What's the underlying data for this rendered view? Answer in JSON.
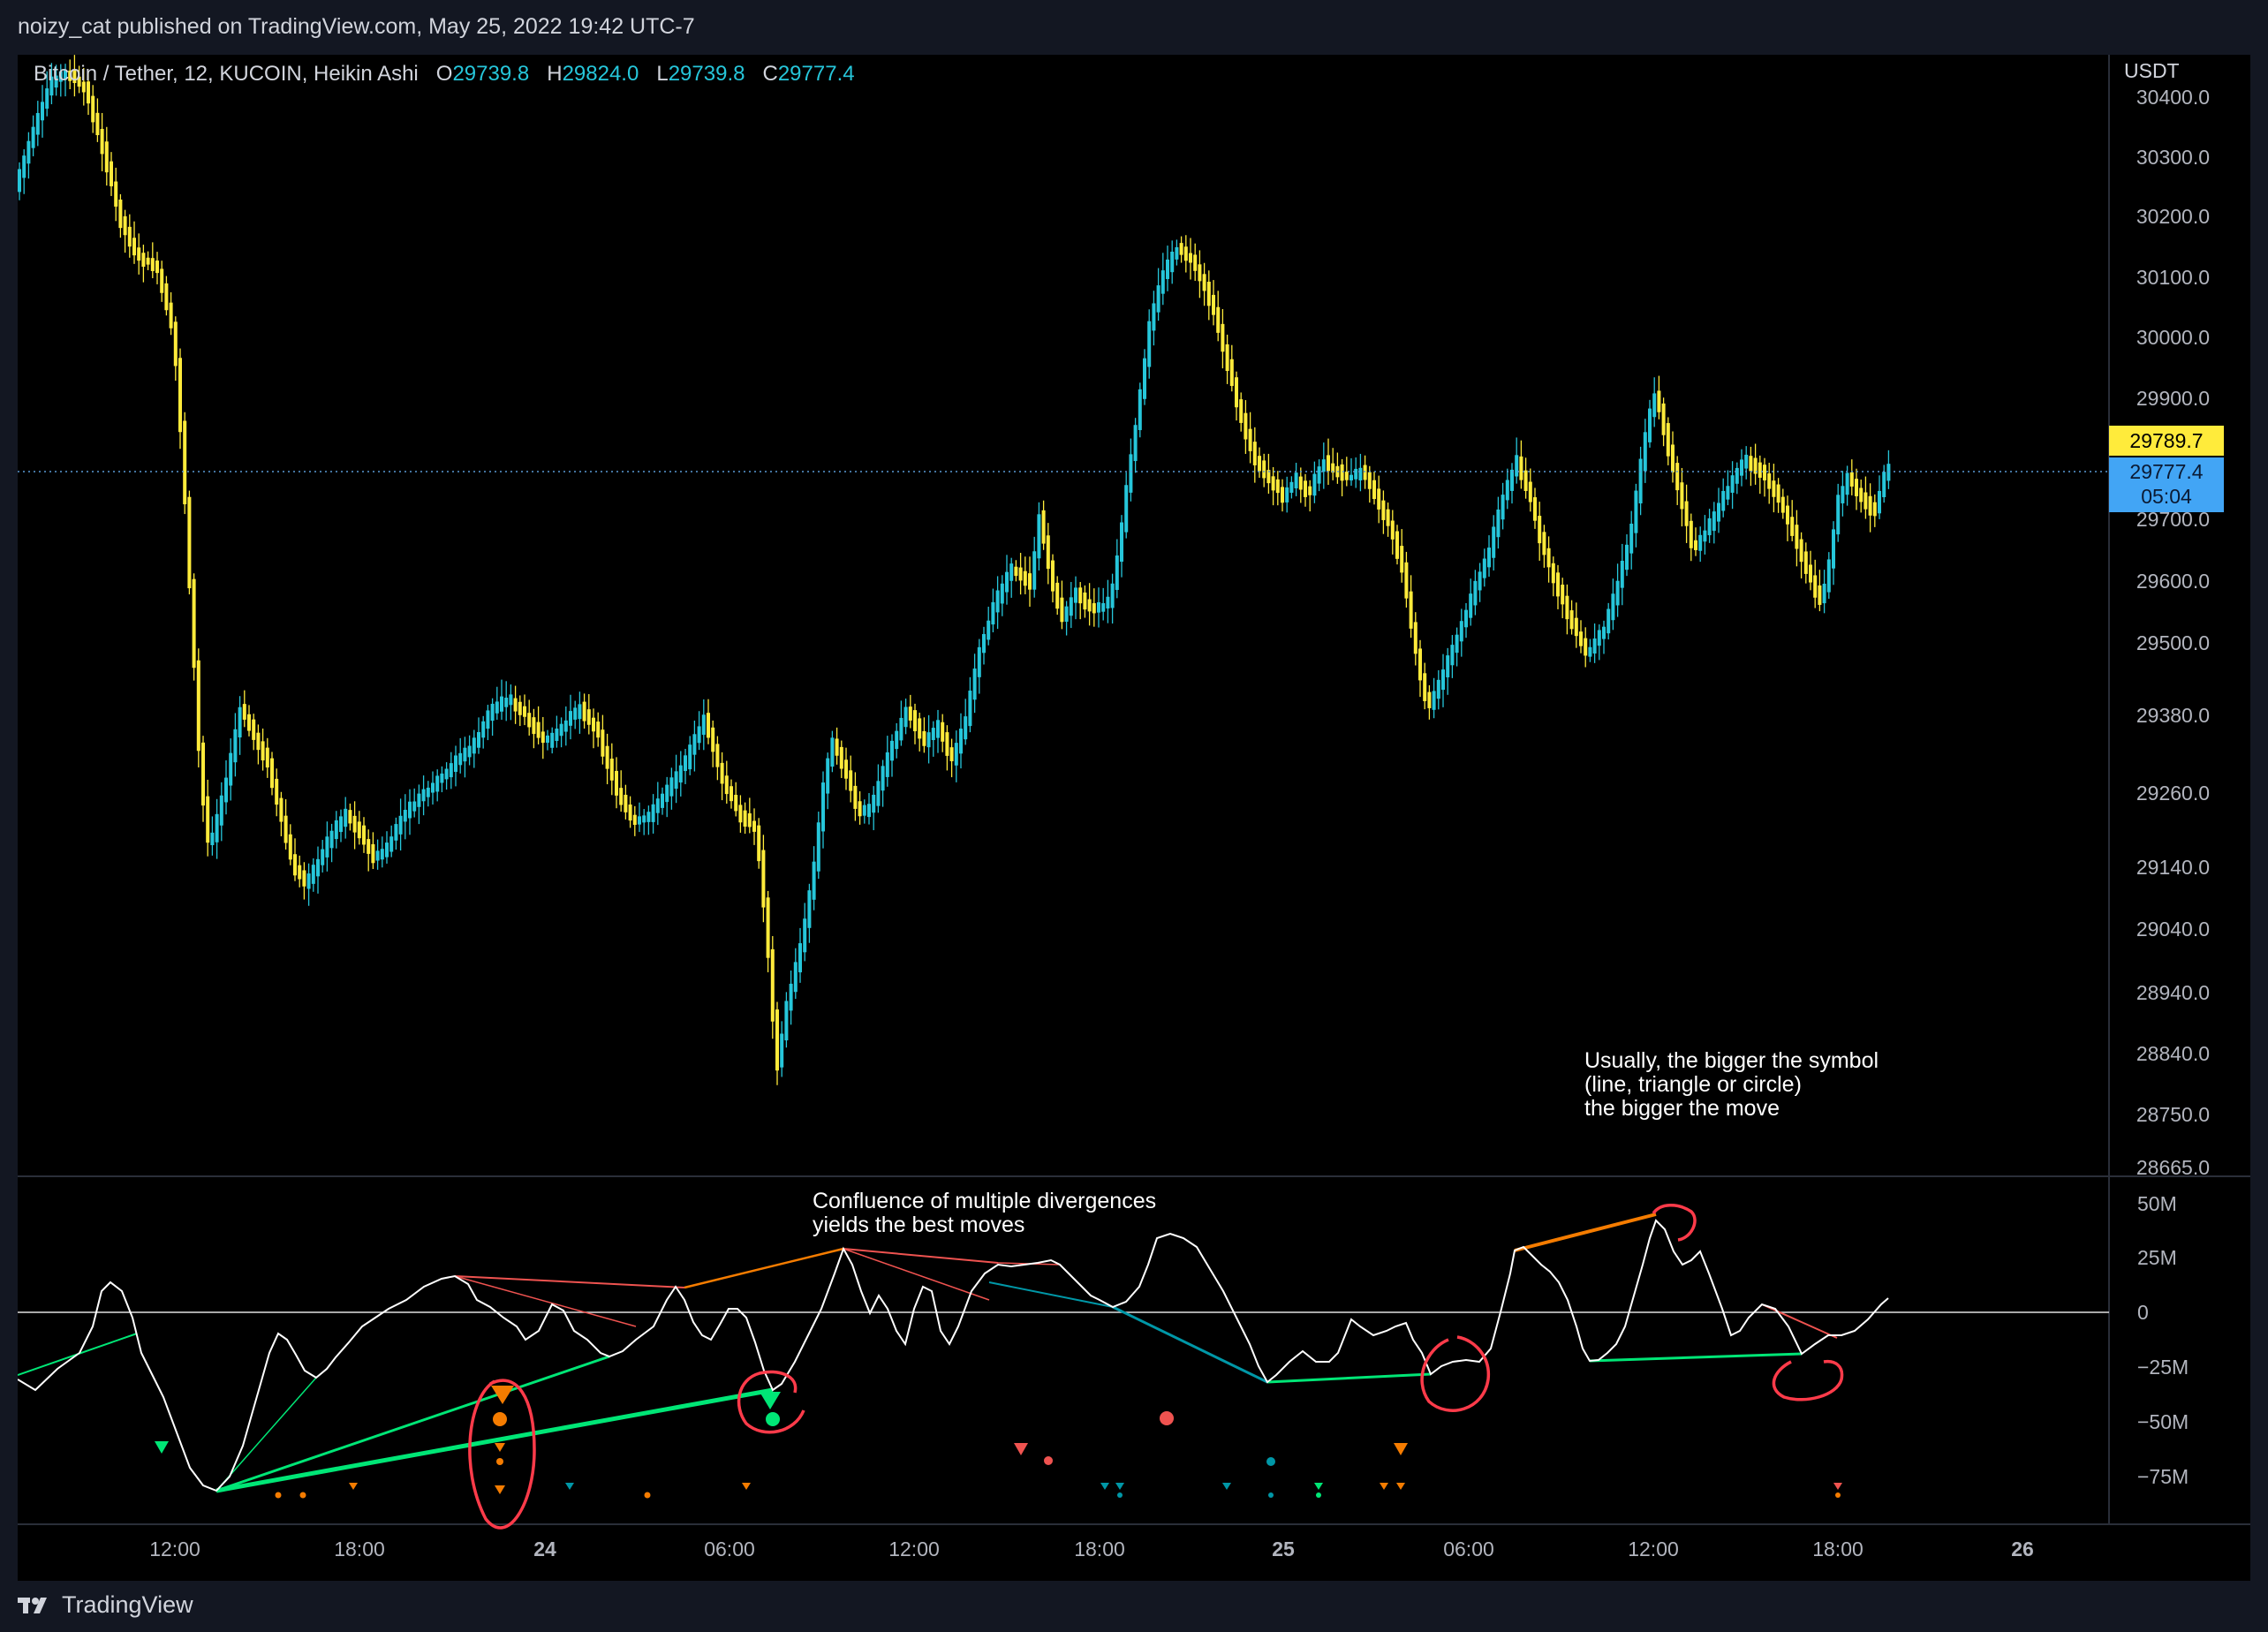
{
  "header": {
    "published": "noizy_cat published on TradingView.com, May 25, 2022 19:42 UTC-7"
  },
  "legend": {
    "symbol": "Bitcoin / Tether, 12, KUCOIN, Heikin Ashi",
    "open_label": "O",
    "open": "29739.8",
    "high_label": "H",
    "high": "29824.0",
    "low_label": "L",
    "low": "29739.8",
    "close_label": "C",
    "close": "29777.4"
  },
  "price_axis": {
    "currency": "USDT",
    "ticks": [
      "30400.0",
      "30300.0",
      "30200.0",
      "30100.0",
      "30000.0",
      "29900.0",
      "29700.0",
      "29600.0",
      "29500.0",
      "29380.0",
      "29260.0",
      "29140.0",
      "29040.0",
      "28940.0",
      "28840.0",
      "28750.0",
      "28665.0"
    ],
    "tag_high": "29789.7",
    "tag_last": "29777.4",
    "tag_countdown": "05:04"
  },
  "osc_axis": {
    "ticks": [
      "50M",
      "25M",
      "0",
      "−25M",
      "−50M",
      "−75M"
    ]
  },
  "time_axis": {
    "ticks": [
      "12:00",
      "18:00",
      "24",
      "06:00",
      "12:00",
      "18:00",
      "25",
      "06:00",
      "12:00",
      "18:00",
      "26"
    ]
  },
  "annotations": {
    "note_size": [
      "Usually, the bigger the symbol",
      "(line, triangle or circle)",
      "the bigger the move"
    ],
    "note_confluence": [
      "Confluence of multiple divergences",
      "yields the best moves"
    ]
  },
  "colors": {
    "bull": "#26c6da",
    "bear": "#ffeb3b",
    "red": "#ef5350",
    "green": "#00e676",
    "orange": "#f57c00",
    "teal": "#0097a7",
    "osc": "#ffffff"
  },
  "footer": {
    "brand": "TradingView",
    "logo_icon": "tradingview-logo-icon"
  }
}
